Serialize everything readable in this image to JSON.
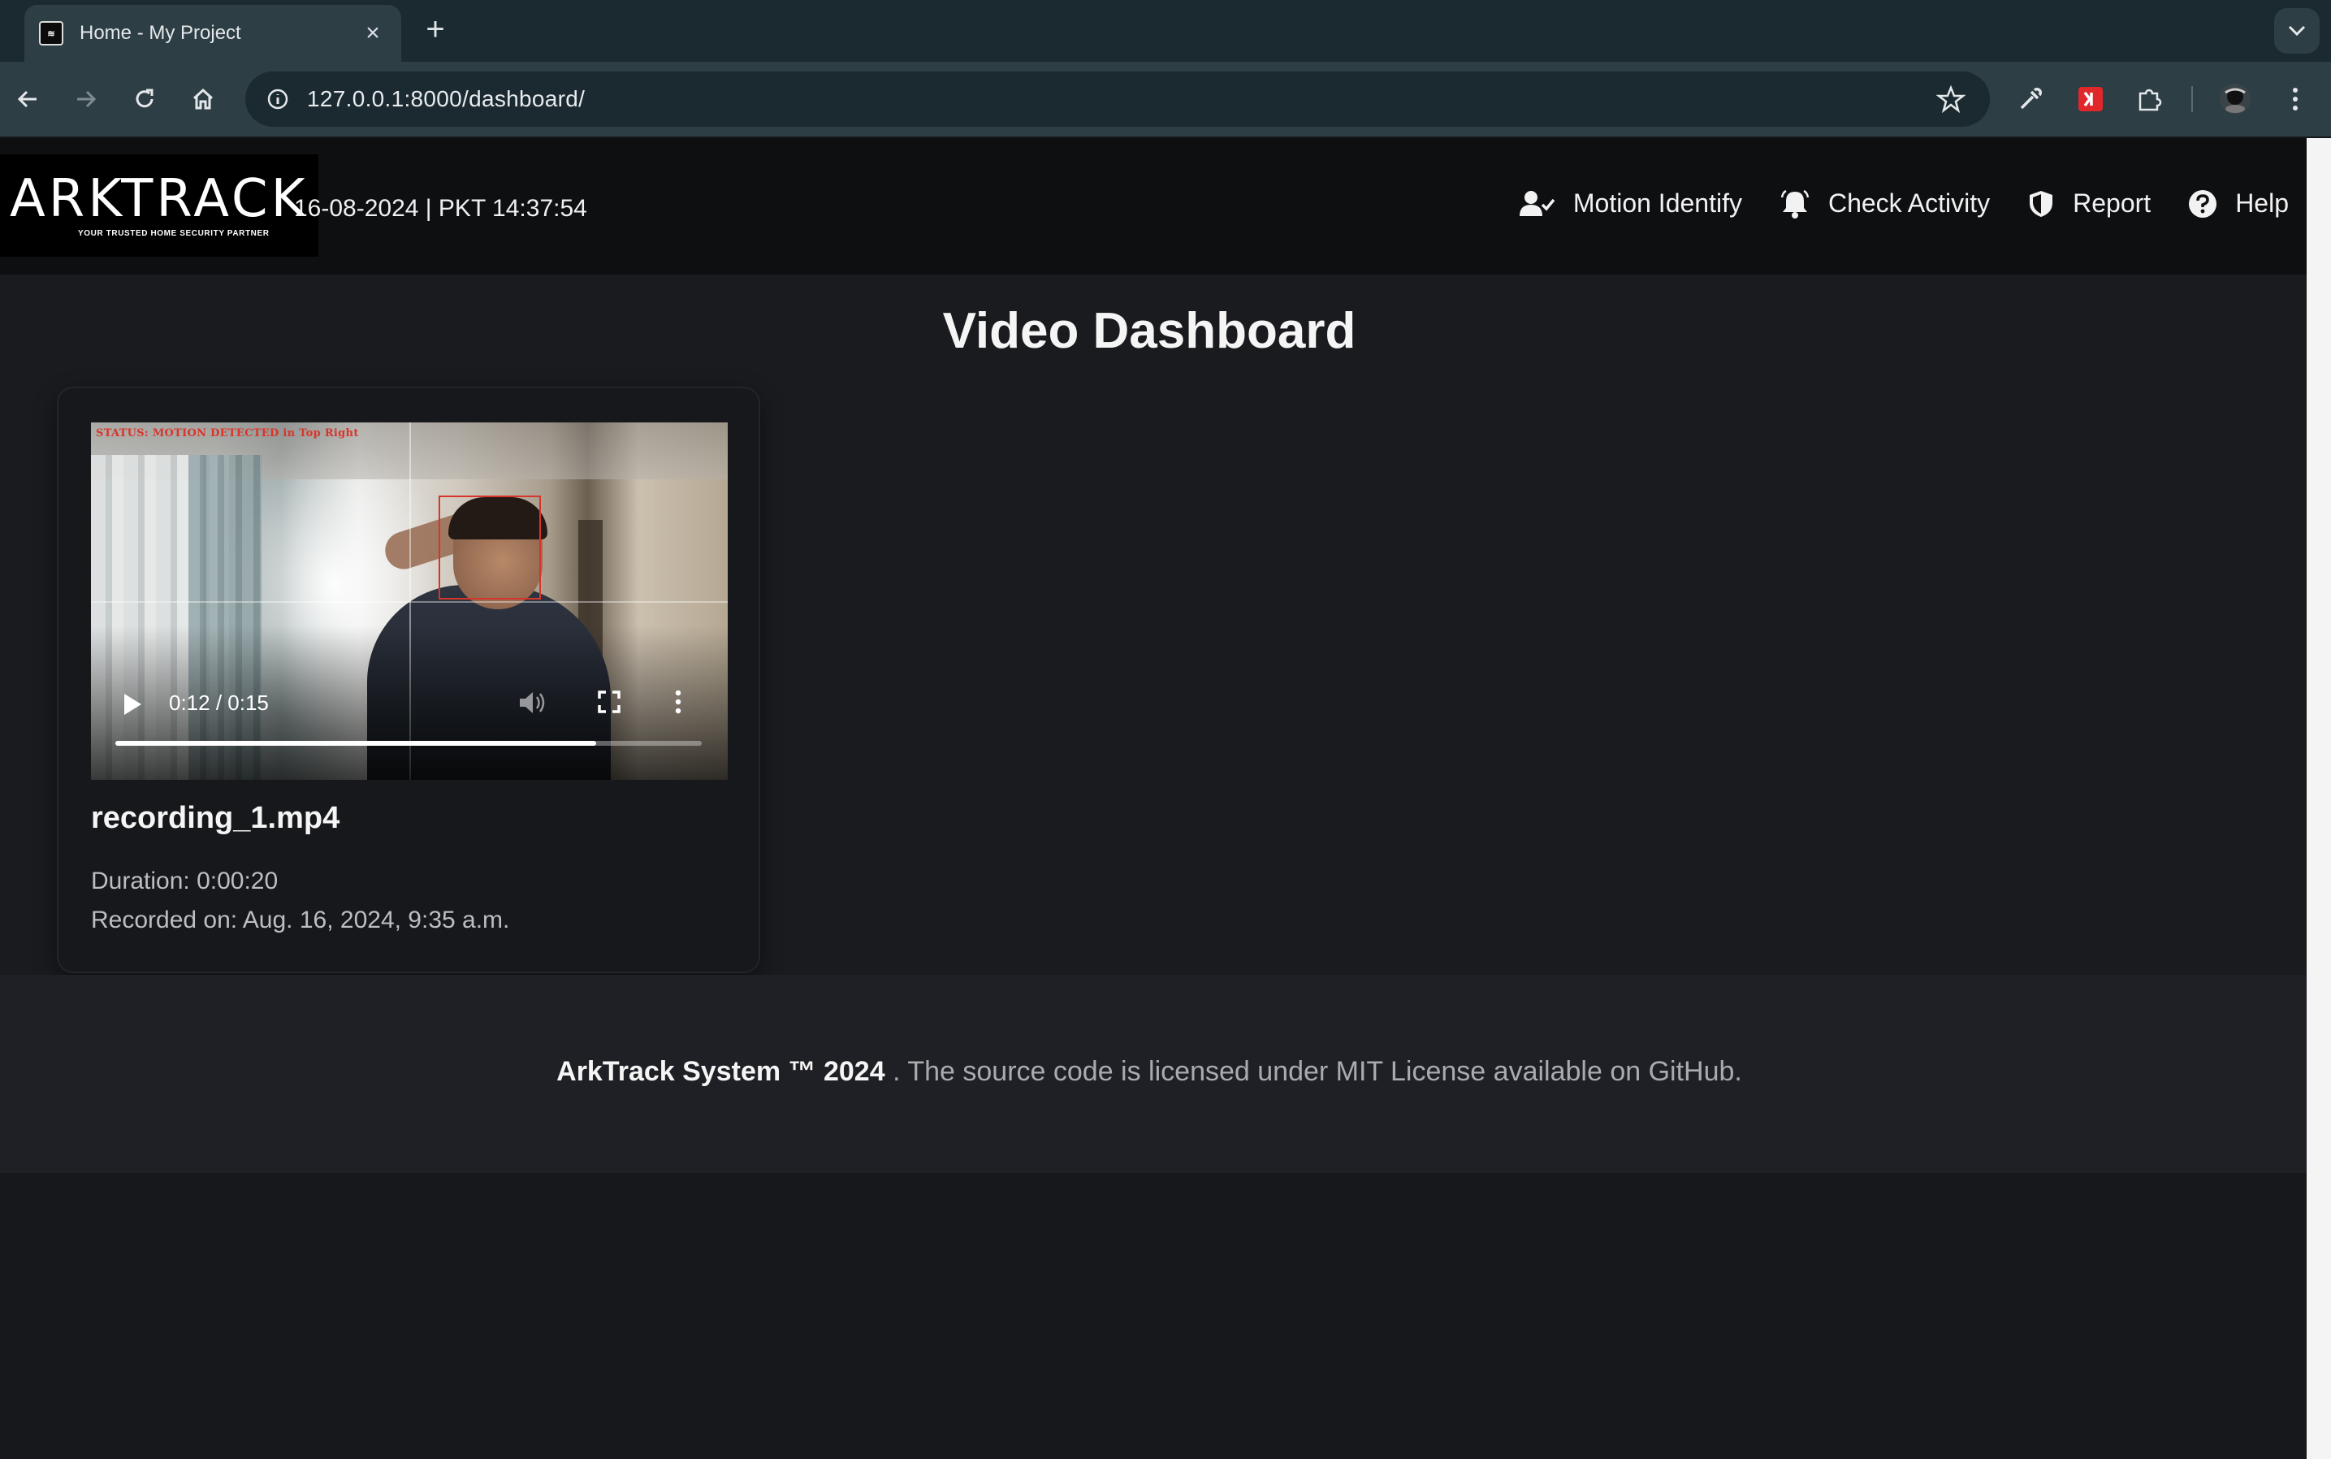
{
  "browser": {
    "tab_title": "Home - My Project",
    "url": "127.0.0.1:8000/dashboard/"
  },
  "header": {
    "logo_text": "ARKTRACK",
    "logo_tagline": "YOUR TRUSTED HOME SECURITY PARTNER",
    "datetime": "16-08-2024 | PKT 14:37:54",
    "nav": [
      {
        "label": "Motion Identify",
        "icon": "user-check-icon"
      },
      {
        "label": "Check Activity",
        "icon": "bell-icon"
      },
      {
        "label": "Report",
        "icon": "shield-icon"
      },
      {
        "label": "Help",
        "icon": "question-circle-icon"
      }
    ]
  },
  "main": {
    "title": "Video Dashboard",
    "videos": [
      {
        "overlay_status": "STATUS: MOTION DETECTED in Top Right",
        "player_time": "0:12 / 0:15",
        "progress": 0.82,
        "filename": "recording_1.mp4",
        "duration": "Duration: 0:00:20",
        "recorded_on": "Recorded on: Aug. 16, 2024, 9:35 a.m."
      }
    ]
  },
  "footer": {
    "brand": "ArkTrack System ™ 2024",
    "text": ". The source code is licensed under MIT License available on GitHub."
  },
  "colors": {
    "header_bg": "#0e0f11",
    "page_bg": "#1a1b1f",
    "motion_box": "#d8352a"
  }
}
